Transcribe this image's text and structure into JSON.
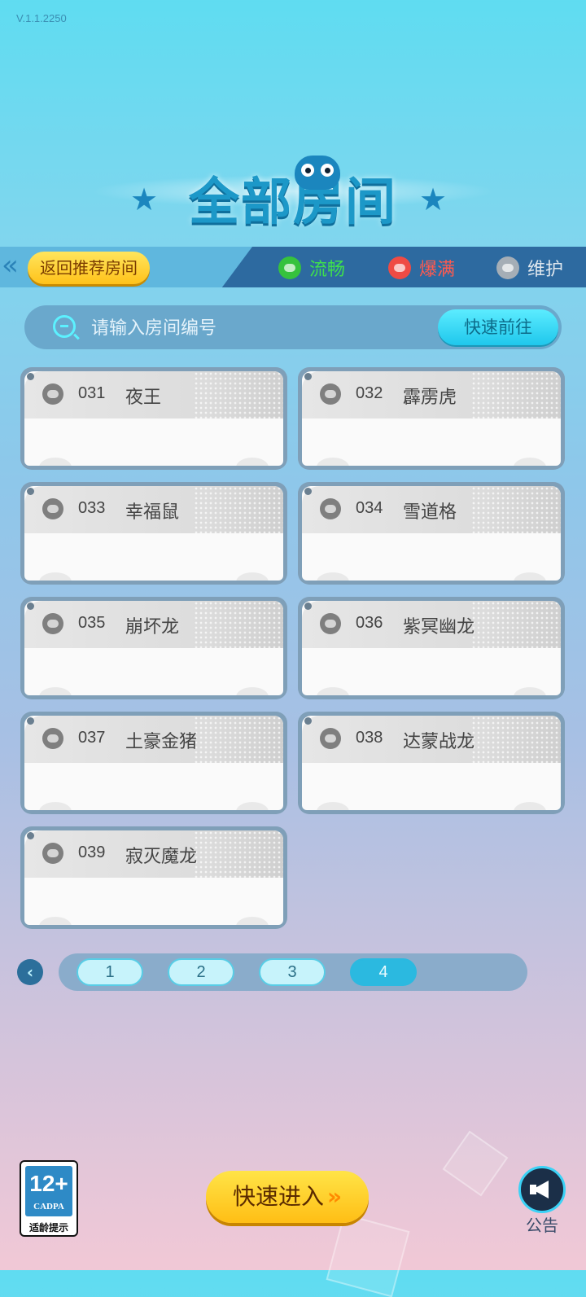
{
  "app": {
    "version": "V.1.1.2250",
    "title": "全部房间"
  },
  "banner": {
    "back_label": "返回推荐房间",
    "legend": [
      {
        "label": "流畅",
        "color": "#36c23d"
      },
      {
        "label": "爆满",
        "color": "#ef4b44"
      },
      {
        "label": "维护",
        "color": "#a5aeb6"
      }
    ]
  },
  "search": {
    "placeholder": "请输入房间编号",
    "value": "",
    "go_label": "快速前往"
  },
  "rooms": [
    {
      "number": "031",
      "name": "夜王",
      "status": "维护"
    },
    {
      "number": "032",
      "name": "霹雳虎",
      "status": "维护"
    },
    {
      "number": "033",
      "name": "幸福鼠",
      "status": "维护"
    },
    {
      "number": "034",
      "name": "雪道格",
      "status": "维护"
    },
    {
      "number": "035",
      "name": "崩坏龙",
      "status": "维护"
    },
    {
      "number": "036",
      "name": "紫冥幽龙",
      "status": "维护"
    },
    {
      "number": "037",
      "name": "土豪金猪",
      "status": "维护"
    },
    {
      "number": "038",
      "name": "达蒙战龙",
      "status": "维护"
    },
    {
      "number": "039",
      "name": "寂灭魔龙",
      "status": "维护"
    }
  ],
  "pagination": {
    "pages": [
      "1",
      "2",
      "3",
      "4"
    ],
    "current": "4"
  },
  "footer": {
    "age_rating": {
      "label": "12+",
      "org": "CADPA",
      "tip": "适龄提示"
    },
    "enter_label": "快速进入",
    "enter_arrows": "»",
    "notice_label": "公告"
  }
}
